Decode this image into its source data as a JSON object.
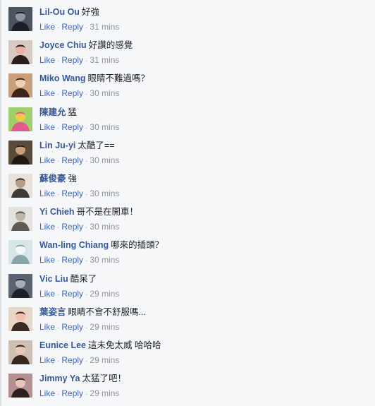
{
  "comments": [
    {
      "name": "Lil-Ou Ou",
      "text": "好強",
      "like": "Like",
      "reply": "Reply",
      "time": "31 mins",
      "avatar": {
        "icon": "avatar-photo",
        "bg": "#4a5560",
        "fg": "#1b1e24",
        "accent": "#8f969c"
      }
    },
    {
      "name": "Joyce Chiu",
      "text": "好讚的感覺",
      "like": "Like",
      "reply": "Reply",
      "time": "31 mins",
      "avatar": {
        "icon": "avatar-photo",
        "bg": "#d8c9c2",
        "fg": "#2b1d1a",
        "accent": "#e8b2a8"
      }
    },
    {
      "name": "Miko Wang",
      "text": "眼睛不難過嗎？",
      "like": "Like",
      "reply": "Reply",
      "time": "30 mins",
      "avatar": {
        "icon": "avatar-photo",
        "bg": "#caa07c",
        "fg": "#3b2619",
        "accent": "#f0d0b0"
      }
    },
    {
      "name": "陳建允",
      "text": "猛",
      "like": "Like",
      "reply": "Reply",
      "time": "30 mins",
      "avatar": {
        "icon": "avatar-photo",
        "bg": "#9fcf68",
        "fg": "#e15a8d",
        "accent": "#f3c94a"
      }
    },
    {
      "name": "Lin Ju-yi",
      "text": "太酷了==",
      "like": "Like",
      "reply": "Reply",
      "time": "30 mins",
      "avatar": {
        "icon": "avatar-photo",
        "bg": "#5a4a38",
        "fg": "#1f1812",
        "accent": "#c9a07e"
      }
    },
    {
      "name": "蘇俊豪",
      "text": "強",
      "like": "Like",
      "reply": "Reply",
      "time": "30 mins",
      "avatar": {
        "icon": "avatar-photo",
        "bg": "#e6e1da",
        "fg": "#3f3a36",
        "accent": "#b59d86"
      }
    },
    {
      "name": "Yi Chieh",
      "text": "哥不是在開車！",
      "like": "Like",
      "reply": "Reply",
      "time": "30 mins",
      "avatar": {
        "icon": "avatar-photo",
        "bg": "#e3e2df",
        "fg": "#5f5a55",
        "accent": "#bdb4aa"
      }
    },
    {
      "name": "Wan-ling Chiang",
      "text": "哪來的插頭？",
      "like": "Like",
      "reply": "Reply",
      "time": "30 mins",
      "avatar": {
        "icon": "avatar-photo",
        "bg": "#d7e6e8",
        "fg": "#8aa5a8",
        "accent": "#f4f7f7"
      }
    },
    {
      "name": "Vic Liu",
      "text": "酷呆了",
      "like": "Like",
      "reply": "Reply",
      "time": "29 mins",
      "avatar": {
        "icon": "avatar-photo",
        "bg": "#5a6470",
        "fg": "#1d2026",
        "accent": "#a7b0b8"
      }
    },
    {
      "name": "葉姿言",
      "text": "眼睛不會不舒服嗎...",
      "like": "Like",
      "reply": "Reply",
      "time": "29 mins",
      "avatar": {
        "icon": "avatar-photo",
        "bg": "#e8d7c8",
        "fg": "#3d2a22",
        "accent": "#f2bfae"
      }
    },
    {
      "name": "Eunice Lee",
      "text": "這未免太威 哈哈哈",
      "like": "Like",
      "reply": "Reply",
      "time": "29 mins",
      "avatar": {
        "icon": "avatar-photo",
        "bg": "#cfbfb2",
        "fg": "#35261e",
        "accent": "#e9c7b5"
      }
    },
    {
      "name": "Jimmy Ya",
      "text": "太猛了吧！",
      "like": "Like",
      "reply": "Reply",
      "time": "29 mins",
      "avatar": {
        "icon": "avatar-photo",
        "bg": "#b58f92",
        "fg": "#2d1f1e",
        "accent": "#e8c6b7"
      }
    }
  ]
}
